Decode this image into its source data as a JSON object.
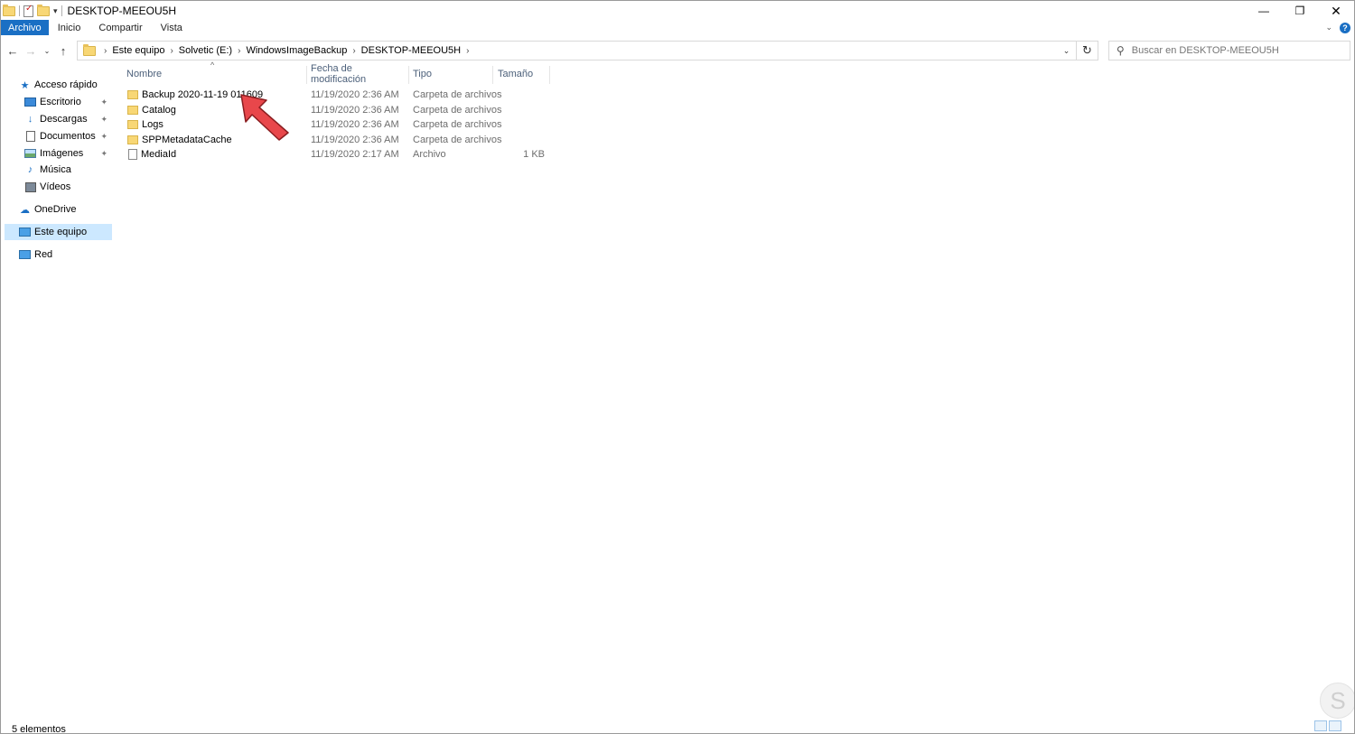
{
  "window": {
    "title": "DESKTOP-MEEOU5H",
    "qat_dropdown": "▾",
    "controls": {
      "minimize": "—",
      "restore": "❐",
      "close": "✕"
    }
  },
  "ribbon": {
    "tabs": [
      "Archivo",
      "Inicio",
      "Compartir",
      "Vista"
    ],
    "expand_icon": "⌄",
    "help_label": "?"
  },
  "nav": {
    "back_icon": "←",
    "forward_icon": "→",
    "recent_icon": "⌄",
    "up_icon": "↑"
  },
  "address": {
    "crumbs": [
      "Este equipo",
      "Solvetic (E:)",
      "WindowsImageBackup",
      "DESKTOP-MEEOU5H"
    ],
    "separator": "›",
    "dropdown_icon": "⌄",
    "refresh_icon": "↻"
  },
  "search": {
    "placeholder": "Buscar en DESKTOP-MEEOU5H",
    "icon": "⚲"
  },
  "navpane": {
    "quick_access": "Acceso rápido",
    "items": [
      {
        "label": "Escritorio",
        "pinned": true
      },
      {
        "label": "Descargas",
        "pinned": true
      },
      {
        "label": "Documentos",
        "pinned": true
      },
      {
        "label": "Imágenes",
        "pinned": true
      },
      {
        "label": "Música",
        "pinned": false
      },
      {
        "label": "Vídeos",
        "pinned": false
      }
    ],
    "onedrive": "OneDrive",
    "this_pc": "Este equipo",
    "network": "Red",
    "pin_icon": "📌"
  },
  "columns": {
    "name": "Nombre",
    "date": "Fecha de modificación",
    "type": "Tipo",
    "size": "Tamaño",
    "sort_indicator": "^"
  },
  "files": [
    {
      "name": "Backup 2020-11-19 011609",
      "date": "11/19/2020 2:36 AM",
      "type": "Carpeta de archivos",
      "size": "",
      "kind": "folder"
    },
    {
      "name": "Catalog",
      "date": "11/19/2020 2:36 AM",
      "type": "Carpeta de archivos",
      "size": "",
      "kind": "folder"
    },
    {
      "name": "Logs",
      "date": "11/19/2020 2:36 AM",
      "type": "Carpeta de archivos",
      "size": "",
      "kind": "folder"
    },
    {
      "name": "SPPMetadataCache",
      "date": "11/19/2020 2:36 AM",
      "type": "Carpeta de archivos",
      "size": "",
      "kind": "folder"
    },
    {
      "name": "MediaId",
      "date": "11/19/2020 2:17 AM",
      "type": "Archivo",
      "size": "1 KB",
      "kind": "file"
    }
  ],
  "status": {
    "item_count": "5 elementos"
  },
  "colors": {
    "accent": "#1a6fc4",
    "selection": "#cce8ff",
    "annotation_arrow": "#e8474b"
  }
}
